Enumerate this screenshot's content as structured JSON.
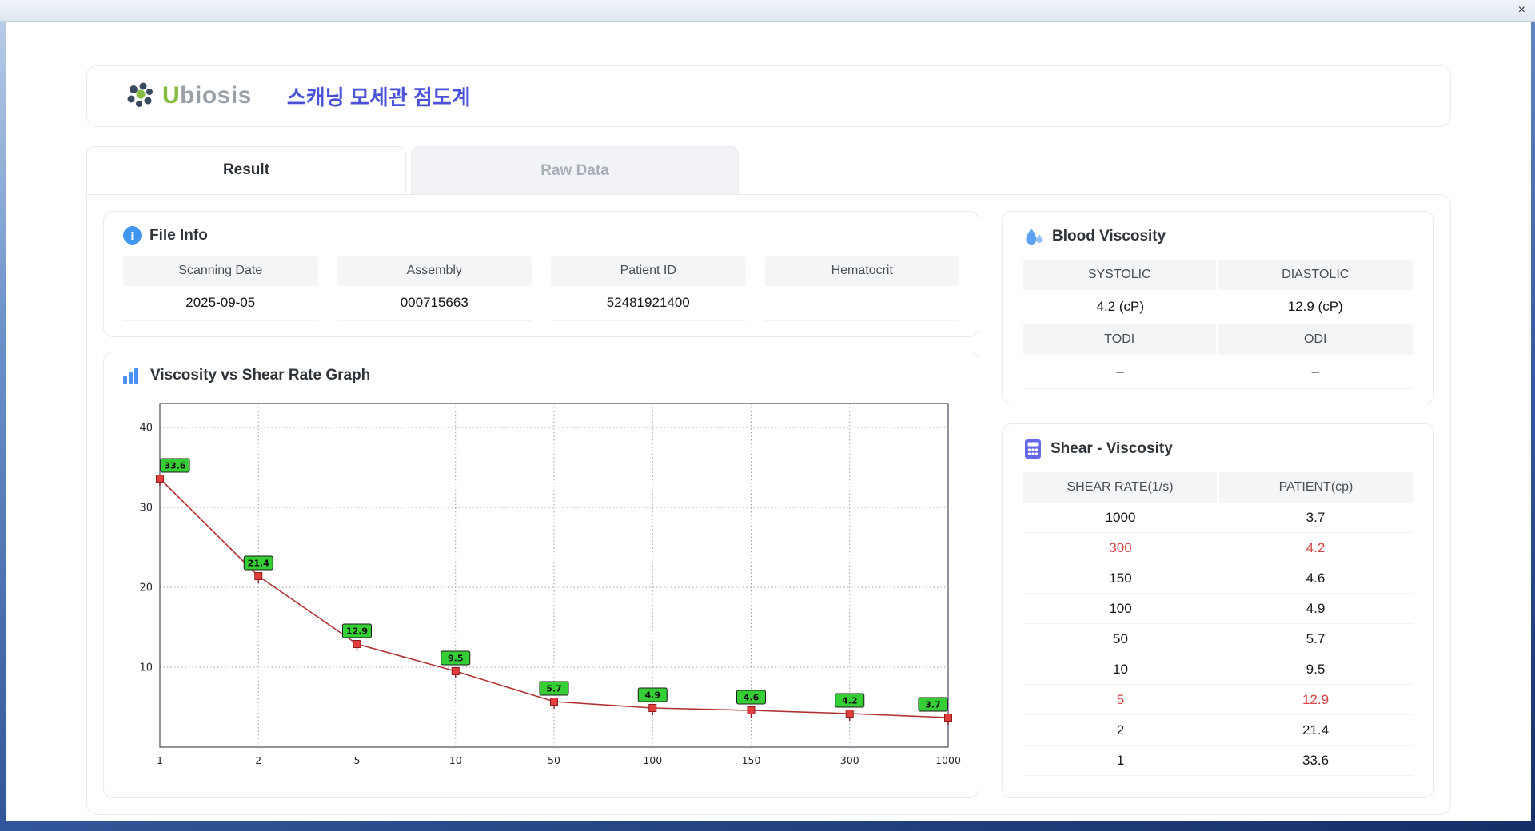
{
  "window": {
    "close_glyph": "×"
  },
  "header": {
    "logo_u": "U",
    "logo_rest": "biosis",
    "title": "스캐닝 모세관 점도계"
  },
  "tabs": [
    {
      "label": "Result",
      "active": true
    },
    {
      "label": "Raw Data",
      "active": false
    }
  ],
  "file_info": {
    "title": "File Info",
    "icon_glyph": "i",
    "fields": [
      {
        "label": "Scanning Date",
        "value": "2025-09-05"
      },
      {
        "label": "Assembly",
        "value": "000715663"
      },
      {
        "label": "Patient ID",
        "value": "52481921400"
      },
      {
        "label": "Hematocrit",
        "value": ""
      }
    ]
  },
  "blood_viscosity": {
    "title": "Blood Viscosity",
    "cells": [
      {
        "label": "SYSTOLIC",
        "value": "4.2 (cP)"
      },
      {
        "label": "DIASTOLIC",
        "value": "12.9 (cP)"
      },
      {
        "label": "TODI",
        "value": "–"
      },
      {
        "label": "ODI",
        "value": "–"
      }
    ]
  },
  "shear_viscosity": {
    "title": "Shear - Viscosity",
    "columns": [
      "SHEAR RATE(1/s)",
      "PATIENT(cp)"
    ],
    "rows": [
      {
        "shear": "1000",
        "patient": "3.7",
        "highlight": false
      },
      {
        "shear": "300",
        "patient": "4.2",
        "highlight": true
      },
      {
        "shear": "150",
        "patient": "4.6",
        "highlight": false
      },
      {
        "shear": "100",
        "patient": "4.9",
        "highlight": false
      },
      {
        "shear": "50",
        "patient": "5.7",
        "highlight": false
      },
      {
        "shear": "10",
        "patient": "9.5",
        "highlight": false
      },
      {
        "shear": "5",
        "patient": "12.9",
        "highlight": true
      },
      {
        "shear": "2",
        "patient": "21.4",
        "highlight": false
      },
      {
        "shear": "1",
        "patient": "33.6",
        "highlight": false
      }
    ]
  },
  "chart_data": {
    "type": "line",
    "title": "Viscosity vs Shear Rate Graph",
    "x_ticks": [
      "1",
      "2",
      "5",
      "10",
      "50",
      "100",
      "150",
      "300",
      "1000"
    ],
    "x": [
      1,
      2,
      5,
      10,
      50,
      100,
      150,
      300,
      1000
    ],
    "values": [
      33.6,
      21.4,
      12.9,
      9.5,
      5.7,
      4.9,
      4.6,
      4.2,
      3.7
    ],
    "y_ticks": [
      10,
      20,
      30,
      40
    ],
    "ylim": [
      0,
      43
    ],
    "x_spacing": "even-categorical",
    "grid": "dotted",
    "legend": "none",
    "line_color": "#b03434",
    "marker_color": "#e33e3e",
    "marker_edge": "#8f1d1d",
    "label_bg": "#35cf35",
    "label_border": "#1a1a1a"
  },
  "colors": {
    "accent_title": "#4a53d8",
    "icon_blue": "#4196f0",
    "icon_indigo": "#6468e8",
    "highlight_red": "#d64545",
    "header_cell_bg": "#f4f5f7"
  }
}
